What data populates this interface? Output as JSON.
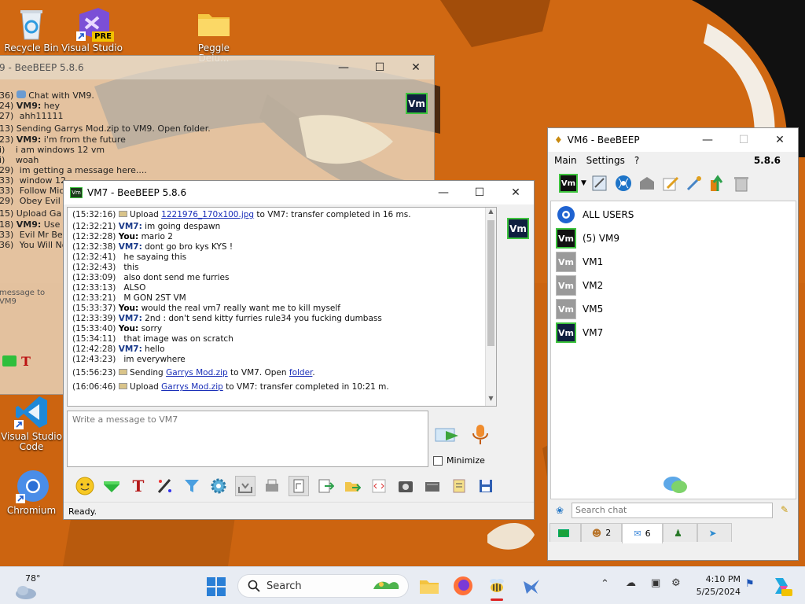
{
  "desktop": {
    "icons": [
      {
        "label": "Recycle Bin"
      },
      {
        "label": "Visual Studio",
        "badge": "PRE"
      },
      {
        "label": "Peggle Delu..."
      },
      {
        "label": "Visual Studio Code"
      },
      {
        "label": "Chromium"
      }
    ]
  },
  "vm9_window": {
    "title": "9 - BeeBEEP 5.8.6",
    "badge": "Vm",
    "lines": [
      {
        "ts": "36)",
        "text": "Chat with VM9."
      },
      {
        "ts": "24)",
        "who": "VM9:",
        "text": " hey"
      },
      {
        "ts": "27)",
        "text": "ahh11111"
      },
      {
        "ts": "13)",
        "text": "Sending Garrys Mod.zip to VM9. Open folder."
      },
      {
        "ts": "23)",
        "who": "VM9:",
        "text": " i'm from the future"
      },
      {
        "ts": "i)",
        "text": "i am windows 12 vm"
      },
      {
        "ts": "i)",
        "text": "woah"
      },
      {
        "ts": "29)",
        "text": "im getting a message here...."
      },
      {
        "ts": "33)",
        "text": "window 12"
      },
      {
        "ts": "33)",
        "text": "Follow Micro"
      },
      {
        "ts": "29)",
        "text": "Obey Evil M"
      },
      {
        "ts": "15)",
        "text": "Upload Ga"
      },
      {
        "ts": "18)",
        "who": "VM9:",
        "text": " Use Co"
      },
      {
        "ts": "33)",
        "text": "Evil Mr Bear"
      },
      {
        "ts": "36)",
        "text": "You Will Not"
      }
    ],
    "input_placeholder": "message to VM9"
  },
  "vm7_window": {
    "title": "VM7 - BeeBEEP 5.8.6",
    "badge": "Vm",
    "log": [
      {
        "ts": "(15:32:16)",
        "pre": " Upload ",
        "link": "1221976_170x100.jpg",
        "post": " to VM7: transfer completed in 16 ms.",
        "icon": true
      },
      {
        "ts": "(12:32:21)",
        "who": "VM7:",
        "text": " im going despawn"
      },
      {
        "ts": "(12:32:28)",
        "me": "You:",
        "text": " mario 2"
      },
      {
        "ts": "(12:32:38)",
        "who": "VM7:",
        "text": " dont   go bro kys KYS !"
      },
      {
        "ts": "(12:32:41)",
        "text": "   he sayaing this"
      },
      {
        "ts": "(12:32:43)",
        "text": "   this"
      },
      {
        "ts": "(12:33:09)",
        "text": "   also dont send me furries"
      },
      {
        "ts": "(12:33:13)",
        "text": "   ALSO"
      },
      {
        "ts": "(12:33:21)",
        "text": "   M GON 2ST VM"
      },
      {
        "ts": "(15:33:37)",
        "me": "You:",
        "text": " would the real vm7 really want me to kill myself"
      },
      {
        "ts": "(12:33:39)",
        "who": "VM7:",
        "text": " 2nd : don't send kitty furries rule34 you fucking dumbass"
      },
      {
        "ts": "(15:33:40)",
        "me": "You:",
        "text": " sorry"
      },
      {
        "ts": "(15:34:11)",
        "text": "   that image was on scratch"
      },
      {
        "ts": "(12:42:28)",
        "who": "VM7:",
        "text": " hello"
      },
      {
        "ts": "(12:43:23)",
        "text": "   im everywhere"
      },
      {
        "ts": "(15:56:23)",
        "pre": " Sending ",
        "link": "Garrys Mod.zip",
        "post": " to VM7. Open ",
        "link2": "folder",
        "post2": ".",
        "icon": true
      },
      {
        "ts": "(16:06:46)",
        "pre": " Upload ",
        "link": "Garrys Mod.zip",
        "post": " to VM7: transfer completed in 10:21 m.",
        "icon": true
      }
    ],
    "input_placeholder": "Write a message to VM7",
    "minimize_label": "Minimize",
    "status": "Ready."
  },
  "vm6_window": {
    "title": "VM6 - BeeBEEP",
    "menu": [
      "Main",
      "Settings",
      "?"
    ],
    "version": "5.8.6",
    "badge": "Vm",
    "users": [
      {
        "label": "ALL USERS",
        "type": "all"
      },
      {
        "label": "(5) VM9",
        "type": "active"
      },
      {
        "label": "VM1",
        "type": "off"
      },
      {
        "label": "VM2",
        "type": "off"
      },
      {
        "label": "VM5",
        "type": "off"
      },
      {
        "label": "VM7",
        "type": "online"
      }
    ],
    "search_placeholder": "Search chat",
    "tabs": [
      {
        "label": ""
      },
      {
        "label": "2"
      },
      {
        "label": "6"
      },
      {
        "label": ""
      },
      {
        "label": ""
      }
    ]
  },
  "taskbar": {
    "weather": "78°",
    "search_label": "Search",
    "time": "4:10 PM",
    "date": "5/25/2024"
  }
}
